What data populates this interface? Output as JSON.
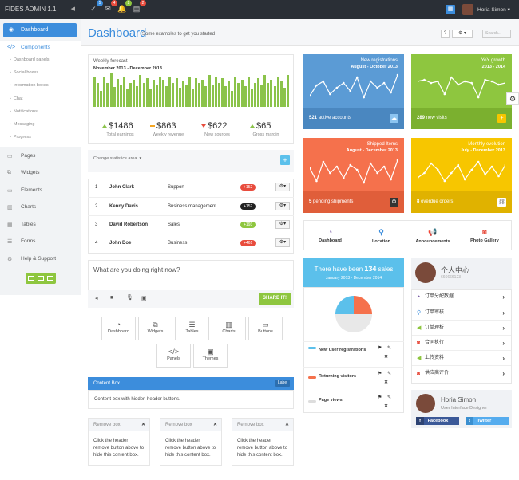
{
  "app": {
    "brand": "FIDES ADMIN 1.1",
    "user": "Horia Simon"
  },
  "colors": {
    "blue": "#5b9bd5",
    "green": "#8ec63f",
    "orange": "#f5714c",
    "yellow": "#f7c600",
    "accent": "#3c8ddc"
  },
  "topnav": {
    "badges": [
      "5",
      "4",
      "2",
      "2"
    ]
  },
  "sidebar": {
    "dashboard": "Dashboard",
    "components": "Components",
    "subitems": [
      "Dashboard panels",
      "Social boxes",
      "Information boxes",
      "Chat",
      "Notifications",
      "Messaging",
      "Progress"
    ],
    "items": [
      "Pages",
      "Widgets",
      "Elements",
      "Charts",
      "Tables",
      "Forms",
      "Help & Support"
    ]
  },
  "header": {
    "title": "Dashboard",
    "subtitle": "Some examples to get you started",
    "help": "?",
    "search": "Search..."
  },
  "forecast": {
    "title": "Weekly forecast",
    "range": "November 2013 - December 2013",
    "bars": [
      38,
      30,
      20,
      38,
      30,
      42,
      25,
      35,
      28,
      38,
      22,
      30,
      34,
      26,
      40,
      30,
      36,
      22,
      34,
      28,
      38,
      34,
      26,
      38,
      30,
      36,
      24,
      32,
      28,
      38,
      22,
      36,
      30,
      34,
      26,
      40,
      28,
      38,
      30,
      36,
      26,
      32,
      20,
      38,
      30,
      34,
      26,
      38,
      22,
      30,
      36,
      28,
      40,
      30,
      34,
      26,
      38,
      32,
      24,
      40
    ],
    "stats": [
      {
        "value": "$1486",
        "label": "Total earnings",
        "trend": "up"
      },
      {
        "value": "$863",
        "label": "Weekly revenue",
        "trend": "flat"
      },
      {
        "value": "$622",
        "label": "New sources",
        "trend": "down"
      },
      {
        "value": "$65",
        "label": "Gross margin",
        "trend": "up"
      }
    ]
  },
  "stats_select": "Change statistics area",
  "table": [
    {
      "n": "1",
      "name": "John Clark",
      "role": "Support",
      "pill": "+152",
      "color": "#e84c3d"
    },
    {
      "n": "2",
      "name": "Kenny Davis",
      "role": "Business management",
      "pill": "+152",
      "color": "#222222"
    },
    {
      "n": "3",
      "name": "David Robertson",
      "role": "Sales",
      "pill": "+193",
      "color": "#8ec63f"
    },
    {
      "n": "4",
      "name": "John Doe",
      "role": "Business",
      "pill": "+461",
      "color": "#e84c3d"
    }
  ],
  "post": {
    "placeholder": "What are you doing right now?",
    "share": "SHARE IT!"
  },
  "tiles": [
    "Dashboard",
    "Widgets",
    "Tables",
    "Charts",
    "Buttons",
    "Panels",
    "Themes"
  ],
  "content_box": {
    "title": "Content Box",
    "label": "Label",
    "text": "Content box with hidden header buttons."
  },
  "remove_boxes": {
    "title": "Remove box",
    "text": "Click the header remove button above to hide this content box."
  },
  "kpis": [
    {
      "title": "New registrations",
      "sub": "August - October 2013",
      "foot_num": "521",
      "foot_text": "active accounts",
      "color": "#5b9bd5",
      "pts": [
        12,
        25,
        30,
        14,
        22,
        28,
        18,
        35,
        10,
        30,
        22,
        28,
        16,
        38
      ]
    },
    {
      "title": "YoY growth",
      "sub": "2013 - 2014",
      "foot_num": "289",
      "foot_text": "new visits",
      "color": "#8ec63f",
      "pts": [
        30,
        32,
        28,
        30,
        14,
        35,
        26,
        30,
        28,
        10,
        32,
        30,
        26,
        28
      ]
    },
    {
      "title": "Shipped Items",
      "sub": "August - December 2013",
      "foot_num": "5",
      "foot_text": "pending shipments",
      "color": "#f5714c",
      "pts": [
        26,
        10,
        34,
        20,
        28,
        14,
        30,
        24,
        8,
        32,
        20,
        28,
        12,
        36
      ]
    },
    {
      "title": "Monthly evolution",
      "sub": "July - December 2013",
      "foot_num": "8",
      "foot_text": "overdue orders",
      "color": "#f7c600",
      "pts": [
        14,
        20,
        32,
        24,
        10,
        20,
        30,
        12,
        24,
        34,
        18,
        28,
        16,
        30
      ]
    }
  ],
  "quick_actions": [
    "Dashboard",
    "Location",
    "Announcements",
    "Photo Gallery"
  ],
  "sales": {
    "prefix": "There have been",
    "num": "134",
    "suffix": "sales",
    "range": "January 2013 - December 2014"
  },
  "pie": [
    {
      "label": "New user registrations",
      "value": 25,
      "color": "#5bc0eb"
    },
    {
      "label": "Returning visitors",
      "value": 25,
      "color": "#f5714c"
    },
    {
      "label": "Page views",
      "value": 50,
      "color": "#e8e8e8"
    }
  ],
  "profile": {
    "name": "个人中心",
    "id": "666666123"
  },
  "profile_links": [
    "订单分配数据",
    "订单审核",
    "订单理析",
    "合同执行",
    "上传资料",
    "供应商评价"
  ],
  "user_card": {
    "name": "Horia Simon",
    "role": "User Interface Designer",
    "facebook": "Facebook",
    "twitter": "Twitter"
  }
}
